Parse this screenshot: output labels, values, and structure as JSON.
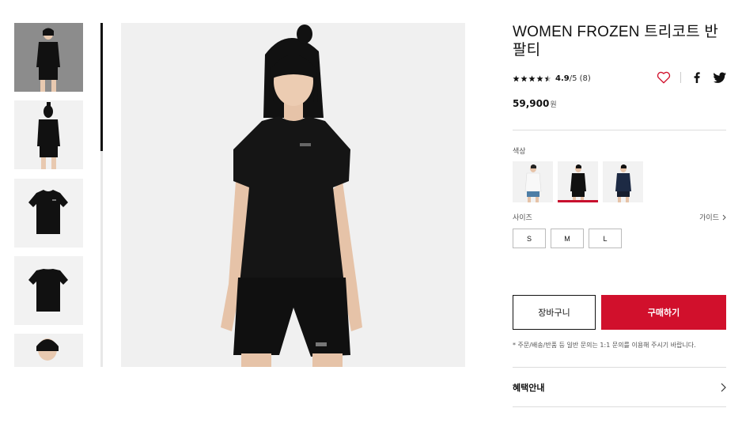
{
  "product": {
    "title": "WOMEN FROZEN 트리코트 반팔티",
    "rating_value": "4.9",
    "rating_suffix": "/5 (8)",
    "stars": 4.9,
    "price_number": "59,900",
    "price_unit": "원"
  },
  "options": {
    "color_label": "색상",
    "size_label": "사이즈",
    "guide_label": "가이드",
    "colors": [
      "white",
      "black",
      "navy"
    ],
    "selected_color": "black",
    "sizes": [
      "S",
      "M",
      "L"
    ]
  },
  "actions": {
    "cart_label": "장바구니",
    "buy_label": "구매하기"
  },
  "notice": "* 주문/배송/반품 등 일반 문의는 1:1 문의를 이용해 주시기 바랍니다.",
  "benefit_label": "혜택안내",
  "icons": {
    "wishlist": "heart-icon",
    "share_facebook": "facebook-icon",
    "share_twitter": "twitter-icon",
    "guide": "chevron-right-icon",
    "benefit": "chevron-right-icon"
  },
  "colors": {
    "accent": "#d1102c",
    "text": "#111111"
  }
}
